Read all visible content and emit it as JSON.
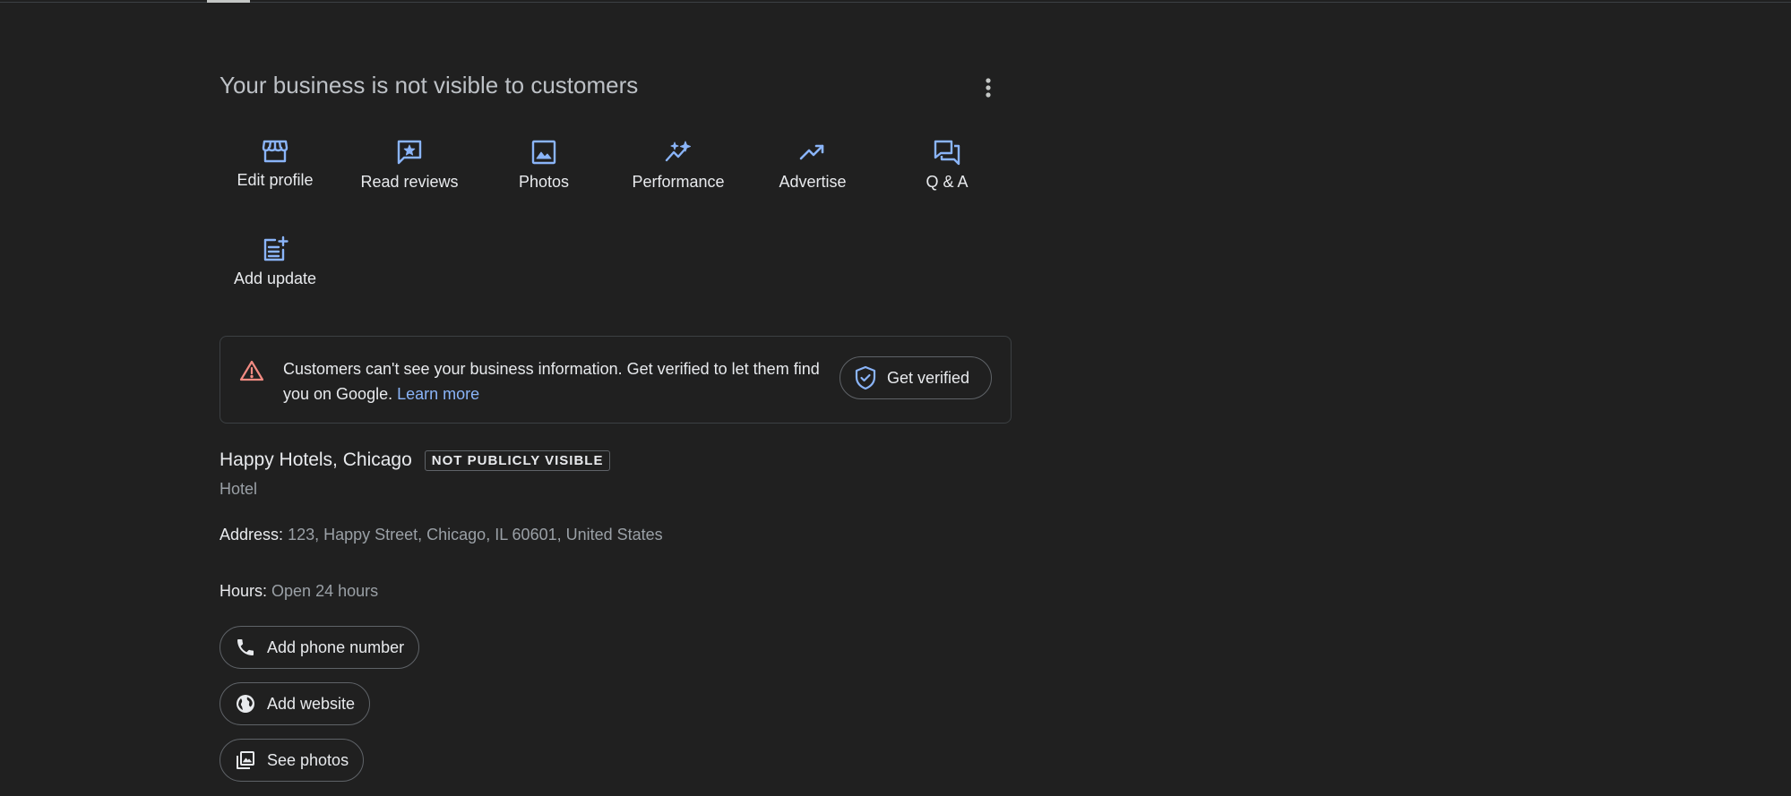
{
  "header": {
    "title": "Your business is not visible to customers"
  },
  "actions": [
    {
      "label": "Edit profile",
      "icon": "storefront-icon"
    },
    {
      "label": "Read reviews",
      "icon": "star-review-icon"
    },
    {
      "label": "Photos",
      "icon": "image-icon"
    },
    {
      "label": "Performance",
      "icon": "sparkle-trend-icon"
    },
    {
      "label": "Advertise",
      "icon": "trending-up-icon"
    },
    {
      "label": "Q & A",
      "icon": "forum-icon"
    },
    {
      "label": "Add update",
      "icon": "post-add-icon"
    }
  ],
  "alert": {
    "text": "Customers can't see your business information. Get verified to let them find you on Google.",
    "link": "Learn more",
    "button": "Get verified"
  },
  "business": {
    "name": "Happy Hotels, Chicago",
    "badge": "NOT PUBLICLY VISIBLE",
    "category": "Hotel",
    "address_label": "Address:",
    "address_value": "123, Happy Street, Chicago, IL 60601, United States",
    "hours_label": "Hours:",
    "hours_value": "Open 24 hours"
  },
  "chips": {
    "phone": "Add phone number",
    "website": "Add website",
    "photos": "See photos"
  },
  "colors": {
    "background": "#202020",
    "accent_blue": "#8ab4f8",
    "warning_red": "#f28b82",
    "muted_text": "#9aa0a6"
  }
}
